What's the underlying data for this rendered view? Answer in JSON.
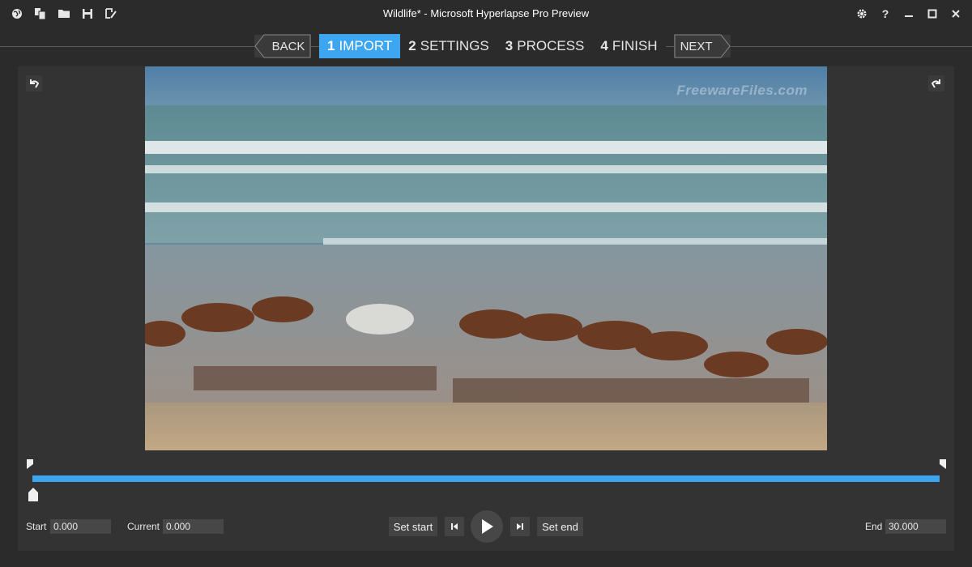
{
  "window": {
    "title": "Wildlife* - Microsoft Hyperlapse Pro Preview"
  },
  "toolbar": {
    "icons": [
      "globe-icon",
      "import-files-icon",
      "open-folder-icon",
      "save-icon",
      "batch-icon"
    ]
  },
  "window_controls": {
    "icons": [
      "settings-icon",
      "help-icon",
      "minimize-icon",
      "maximize-icon",
      "close-icon"
    ],
    "help_glyph": "?"
  },
  "wizard": {
    "back_label": "BACK",
    "next_label": "NEXT",
    "steps": [
      {
        "number": "1",
        "label": "IMPORT",
        "active": true
      },
      {
        "number": "2",
        "label": "SETTINGS",
        "active": false
      },
      {
        "number": "3",
        "label": "PROCESS",
        "active": false
      },
      {
        "number": "4",
        "label": "FINISH",
        "active": false
      }
    ]
  },
  "preview": {
    "watermark": "FreewareFiles.com"
  },
  "timeline": {
    "progress": 0.0
  },
  "controls": {
    "start_label": "Start",
    "start_value": "0.000",
    "current_label": "Current",
    "current_value": "0.000",
    "set_start_label": "Set start",
    "set_end_label": "Set end",
    "end_label": "End",
    "end_value": "30.000"
  },
  "colors": {
    "accent": "#3ea6f0",
    "background": "#2b2b2b",
    "panel": "#333333"
  }
}
